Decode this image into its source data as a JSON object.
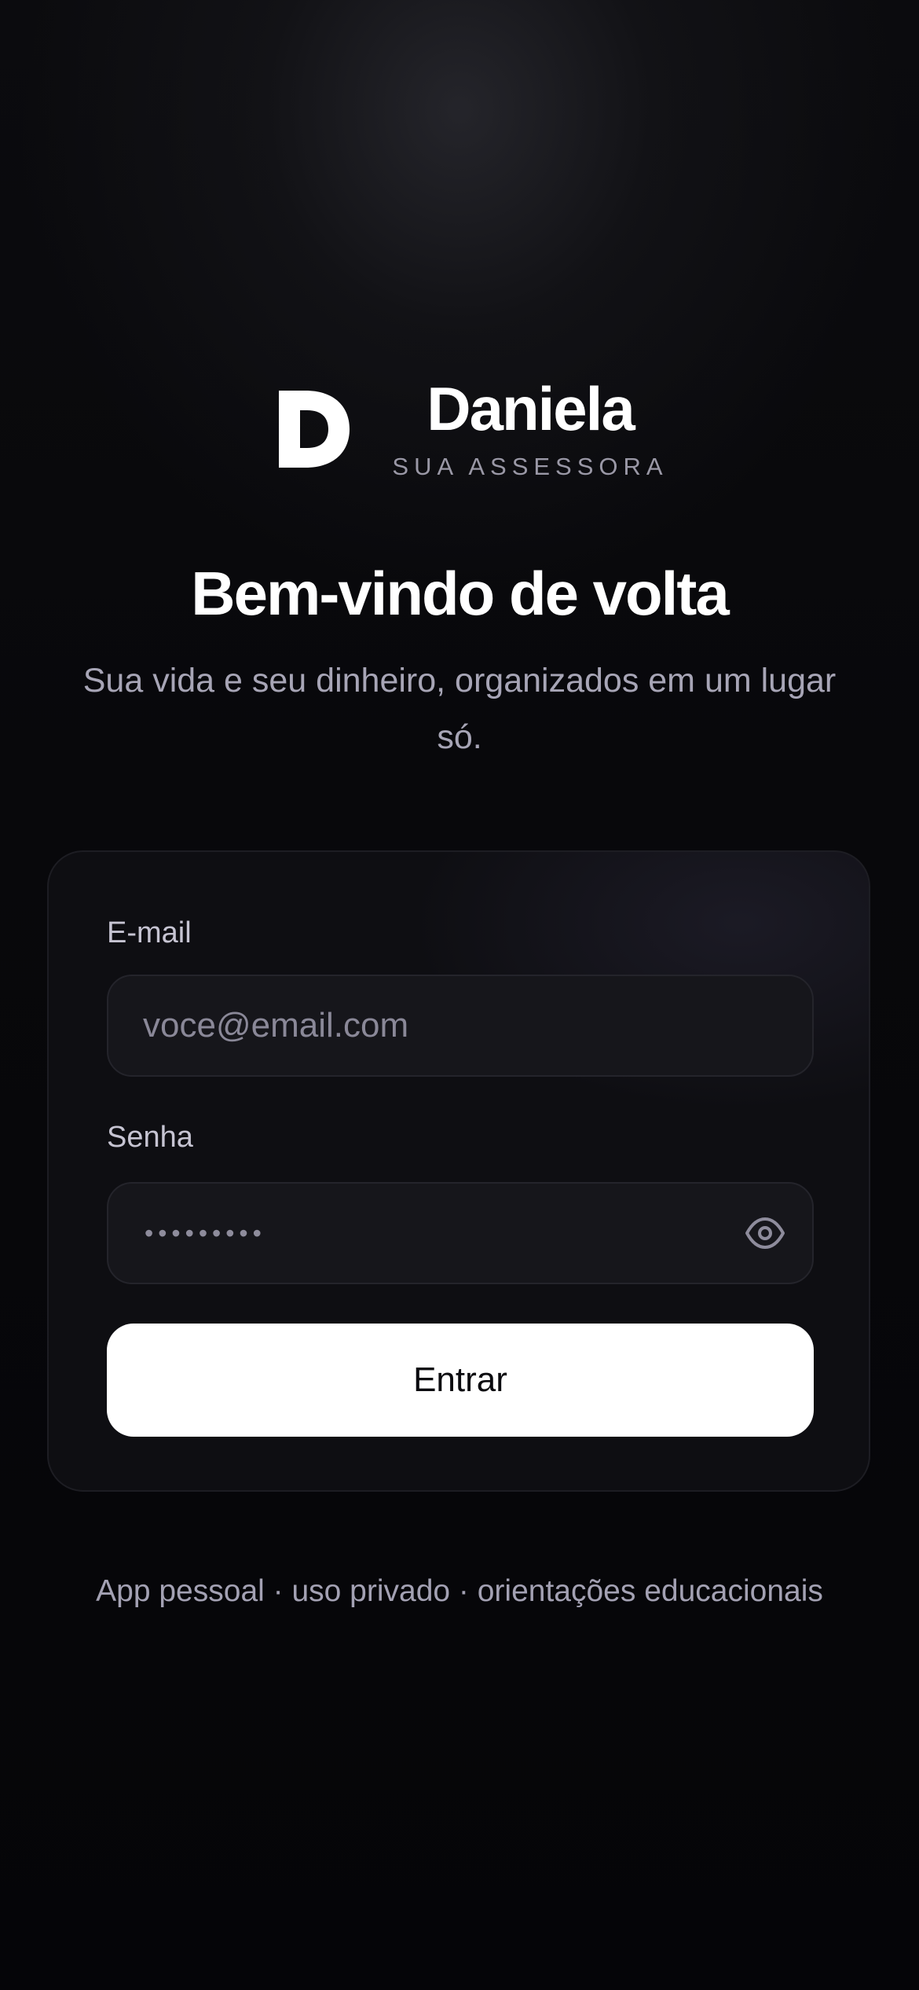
{
  "brand": {
    "name": "Daniela",
    "tagline": "SUA ASSESSORA",
    "logo_icon": "letter-d-logo"
  },
  "hero": {
    "title": "Bem-vindo de volta",
    "subtitle": "Sua vida e seu dinheiro, organizados em um lugar só."
  },
  "form": {
    "email_label": "E-mail",
    "email_placeholder": "voce@email.com",
    "email_value": "",
    "password_label": "Senha",
    "password_mask": "•••••••••",
    "password_toggle_icon": "eye-icon",
    "submit_label": "Entrar"
  },
  "footer": {
    "text": "App pessoal · uso privado · orientações educacionais"
  },
  "colors": {
    "background": "#050508",
    "card": "#0e0e12",
    "input": "#16161b",
    "primary_button": "#ffffff",
    "muted_text": "#a7a5b6"
  }
}
